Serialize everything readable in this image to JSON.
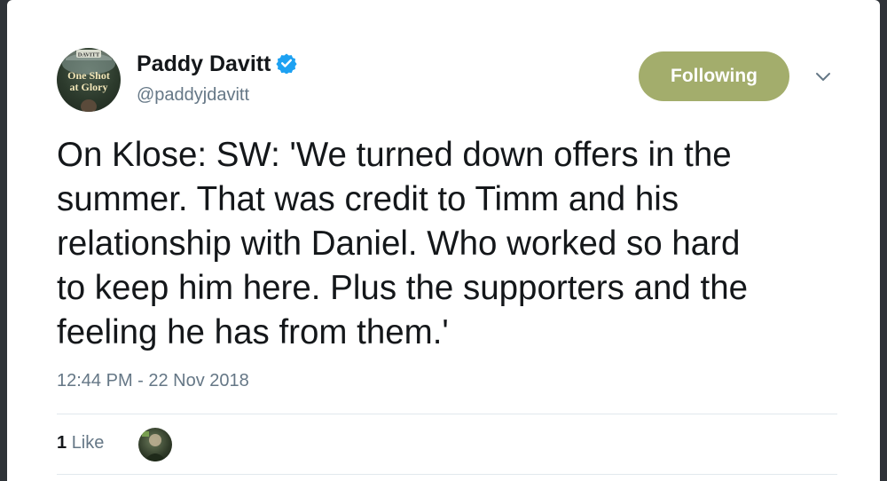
{
  "author": {
    "display_name": "Paddy Davitt",
    "handle": "@paddyjdavitt",
    "avatar_text_line1": "One Shot",
    "avatar_text_line2": "at Glory",
    "avatar_badge": "DAVITT",
    "verified": true
  },
  "follow_button": {
    "label": "Following",
    "color": "#a3ad6c"
  },
  "menu": {
    "icon": "chevron-down-icon"
  },
  "tweet": {
    "text": "On Klose: SW: 'We turned down offers in the\nsummer. That was credit to Timm and his\nrelationship with Daniel. Who worked so hard\nto keep him here. Plus the supporters and the\nfeeling he has from them.'",
    "timestamp": "12:44 PM - 22 Nov 2018"
  },
  "stats": {
    "like_count": "1",
    "like_label": "Like"
  },
  "colors": {
    "verified_blue": "#1da1f2",
    "muted_text": "#657786",
    "primary_text": "#14171a",
    "divider": "#e1e8ed"
  }
}
